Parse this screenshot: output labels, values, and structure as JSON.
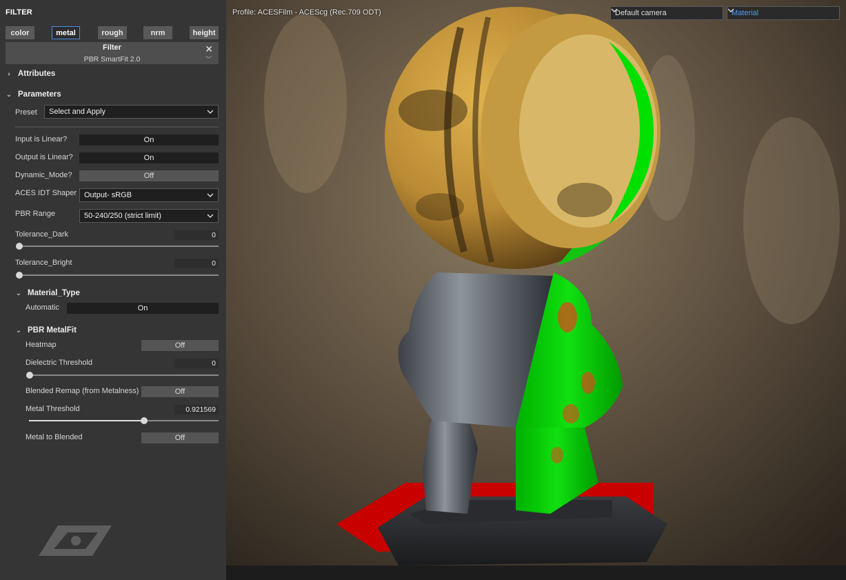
{
  "panel": {
    "title": "FILTER",
    "channel_tabs": [
      {
        "label": "color",
        "active": false
      },
      {
        "label": "metal",
        "active": true
      },
      {
        "label": "rough",
        "active": false
      },
      {
        "label": "nrm",
        "active": false
      },
      {
        "label": "height",
        "active": false
      }
    ],
    "filter": {
      "title": "Filter",
      "name": "PBR SmartFit 2.0"
    },
    "sections": {
      "attributes": "Attributes",
      "parameters": "Parameters",
      "material_type": "Material_Type",
      "pbr_metalfit": "PBR MetalFit"
    },
    "preset": {
      "label": "Preset",
      "value": "Select and Apply"
    },
    "params": {
      "input_linear": {
        "label": "Input is Linear?",
        "value": "On"
      },
      "output_linear": {
        "label": "Output is Linear?",
        "value": "On"
      },
      "dynamic_mode": {
        "label": "Dynamic_Mode?",
        "value": "Off"
      },
      "aces_idt": {
        "label": "ACES IDT Shaper",
        "value": "Output- sRGB"
      },
      "pbr_range": {
        "label": "PBR Range",
        "value": "50-240/250 (strict  limit)"
      },
      "tolerance_dark": {
        "label": "Tolerance_Dark",
        "value": "0",
        "level": 0
      },
      "tolerance_bright": {
        "label": "Tolerance_Bright",
        "value": "0",
        "level": 0
      }
    },
    "material_type": {
      "automatic": {
        "label": "Automatic",
        "value": "On"
      }
    },
    "metalfit": {
      "heatmap": {
        "label": "Heatmap",
        "value": "Off"
      },
      "dielectric_threshold": {
        "label": "Dielectric Threshold",
        "value": "0",
        "level": 0
      },
      "blended_remap": {
        "label": "Blended Remap (from Metalness)",
        "value": "Off"
      },
      "metal_threshold": {
        "label": "Metal Threshold",
        "value": "0.921569",
        "level": 0.921569
      },
      "metal_to_blended": {
        "label": "Metal to Blended",
        "value": "Off"
      }
    }
  },
  "viewport": {
    "profile": "Profile: ACESFilm - ACEScg (Rec.709 ODT)",
    "camera": "Default camera",
    "channel": "Material"
  },
  "colors": {
    "accent": "#4a8fe7",
    "metal_green": "#00d400",
    "heat_red": "#e8401c"
  }
}
